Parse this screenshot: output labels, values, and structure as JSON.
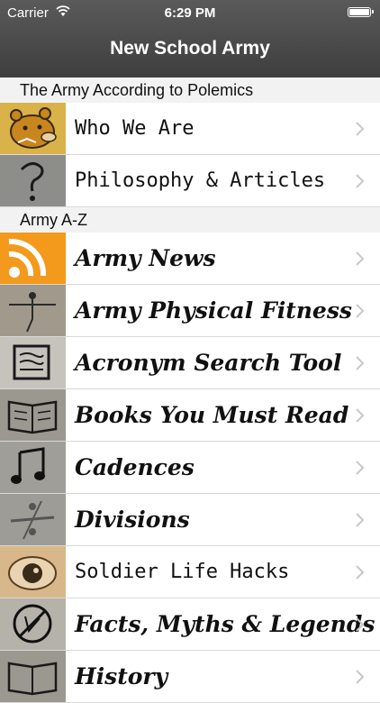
{
  "status": {
    "carrier": "Carrier",
    "time": "6:29 PM"
  },
  "nav": {
    "title": "New School Army"
  },
  "sections": [
    {
      "header": "The Army According to Polemics",
      "items": [
        {
          "label": "Who We Are",
          "icon": "bear-icon"
        },
        {
          "label": "Philosophy & Articles",
          "icon": "question-mark-icon"
        }
      ]
    },
    {
      "header": "Army A-Z",
      "items": [
        {
          "label": "Army News",
          "icon": "rss-icon"
        },
        {
          "label": "Army Physical Fitness",
          "icon": "stick-figure-icon"
        },
        {
          "label": "Acronym Search Tool",
          "icon": "document-icon"
        },
        {
          "label": "Books You Must Read",
          "icon": "book-icon"
        },
        {
          "label": "Cadences",
          "icon": "music-note-icon"
        },
        {
          "label": "Divisions",
          "icon": "divide-icon"
        },
        {
          "label": "Soldier Life Hacks",
          "icon": "eye-icon"
        },
        {
          "label": "Facts, Myths & Legends",
          "icon": "no-symbol-icon"
        },
        {
          "label": "History",
          "icon": "book-icon"
        }
      ]
    }
  ],
  "colors": {
    "navbar": "#4a4a4a",
    "rss": "#f39a1c",
    "chevron": "#c7c7cc"
  }
}
